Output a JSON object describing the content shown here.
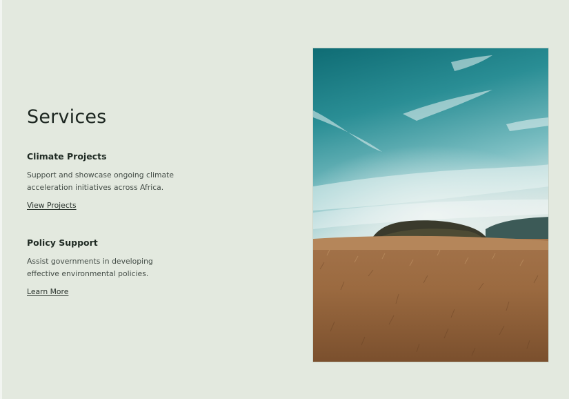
{
  "section": {
    "title": "Services"
  },
  "services": [
    {
      "title": "Climate Projects",
      "description": "Support and showcase ongoing climate acceleration initiatives across Africa.",
      "link_label": "View Projects"
    },
    {
      "title": "Policy Support",
      "description": "Assist governments in developing effective environmental policies.",
      "link_label": "Learn More"
    }
  ],
  "image": {
    "alt": "landscape-photo"
  },
  "colors": {
    "background": "#e3e9df",
    "text": "#1f2a23",
    "sky": "#2f8f97",
    "grass": "#9a6a3f"
  }
}
